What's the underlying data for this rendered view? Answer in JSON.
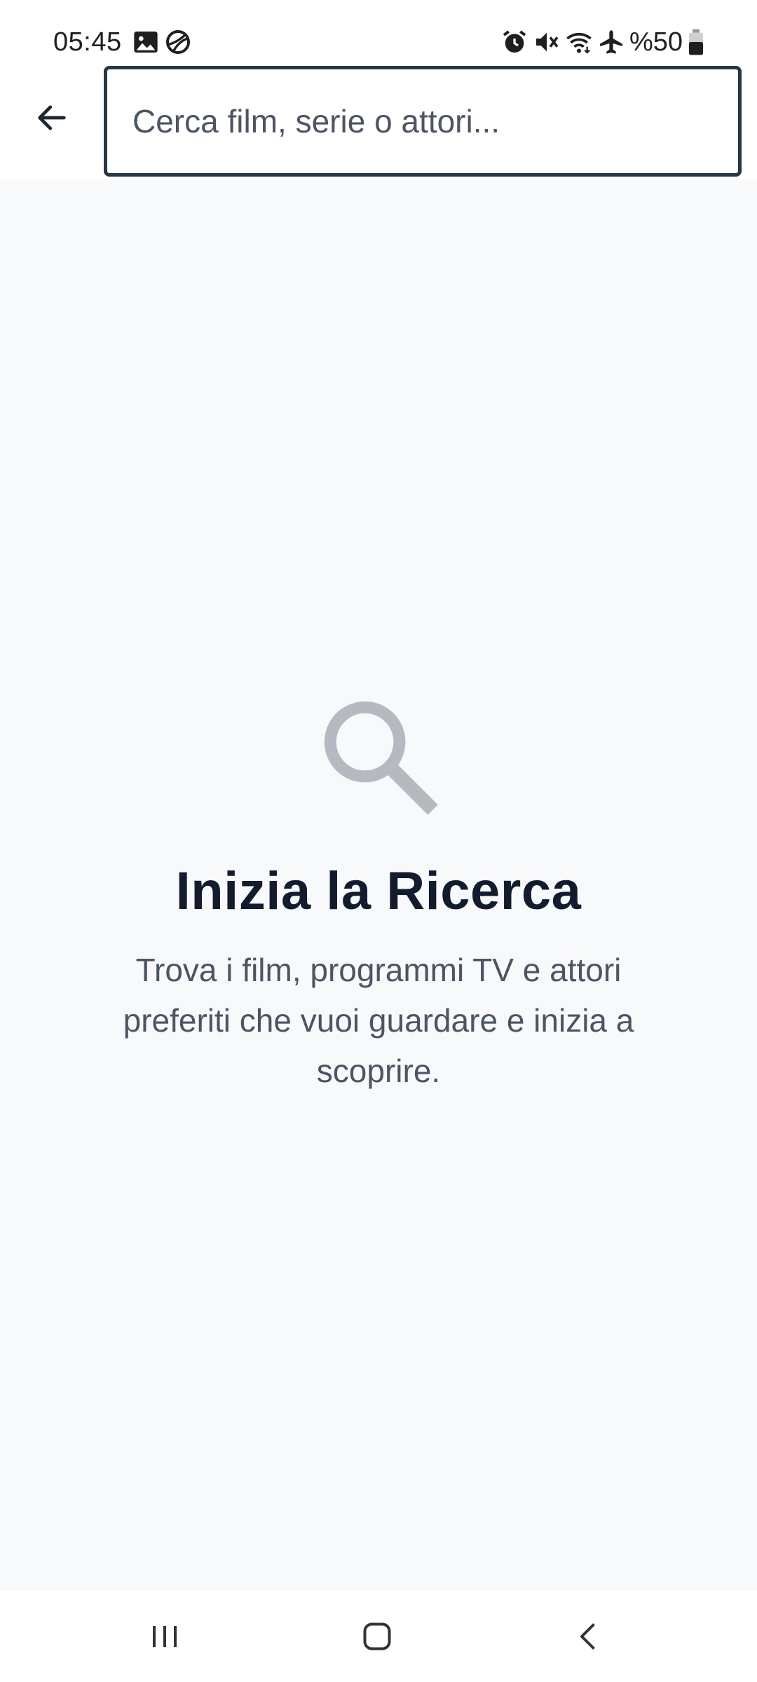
{
  "status_bar": {
    "time": "05:45",
    "battery_text": "%50",
    "left_icons": [
      "image-icon",
      "vpn-globe-icon"
    ],
    "right_icons": [
      "alarm-icon",
      "mute-icon",
      "wifi-icon",
      "airplane-icon",
      "battery-icon"
    ]
  },
  "search": {
    "placeholder": "Cerca film, serie o attori...",
    "value": ""
  },
  "empty_state": {
    "icon": "search-icon",
    "title": "Inizia la Ricerca",
    "description": "Trova i film, programmi TV e attori preferiti che vuoi guardare e inizia a scoprire."
  },
  "nav_bar": {
    "buttons": [
      "recent-apps-icon",
      "home-icon",
      "back-icon"
    ]
  },
  "colors": {
    "accent_border": "#2a3644",
    "title": "#131c2e",
    "muted_text": "#4b5563",
    "background": "#f8f9fb",
    "icon_gray": "#b5bac1"
  }
}
